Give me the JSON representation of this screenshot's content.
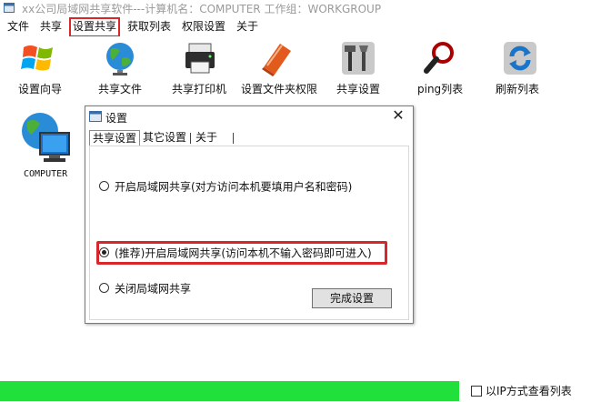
{
  "window": {
    "title": "xx公司局域网共享软件---计算机名：COMPUTER   工作组：WORKGROUP"
  },
  "menu": {
    "items": [
      {
        "label": "文件"
      },
      {
        "label": "共享"
      },
      {
        "label": "设置共享",
        "highlighted": true
      },
      {
        "label": "获取列表"
      },
      {
        "label": "权限设置"
      },
      {
        "label": "关于"
      }
    ]
  },
  "toolbar": {
    "items": [
      {
        "label": "设置向导",
        "icon": "windows-logo-icon"
      },
      {
        "label": "共享文件",
        "icon": "globe-icon"
      },
      {
        "label": "共享打印机",
        "icon": "printer-icon"
      },
      {
        "label": "设置文件夹权限",
        "icon": "folder-book-icon"
      },
      {
        "label": "共享设置",
        "icon": "tools-icon"
      },
      {
        "label": "ping列表",
        "icon": "magnifier-icon"
      },
      {
        "label": "刷新列表",
        "icon": "refresh-icon"
      }
    ]
  },
  "workspace": {
    "computers": [
      {
        "label": "COMPUTER",
        "icon": "network-computer-icon"
      }
    ]
  },
  "dialog": {
    "title": "设置",
    "close_label": "✕",
    "tabs": [
      {
        "label": "共享设置",
        "active": true
      },
      {
        "label": "其它设置",
        "active": false
      },
      {
        "label": "关于",
        "active": false
      }
    ],
    "options": [
      {
        "label": "开启局域网共享(对方访问本机要填用户名和密码)",
        "checked": false
      },
      {
        "label": "(推荐)开启局域网共享(访问本机不输入密码即可进入)",
        "checked": true,
        "highlighted": true
      },
      {
        "label": "关闭局域网共享",
        "checked": false
      }
    ],
    "finish_label": "完成设置"
  },
  "status": {
    "progress": 1.0,
    "progress_color": "#22e03c",
    "ip_view_label": "以IP方式查看列表",
    "ip_view_checked": false
  },
  "colors": {
    "highlight": "#d8262b"
  }
}
